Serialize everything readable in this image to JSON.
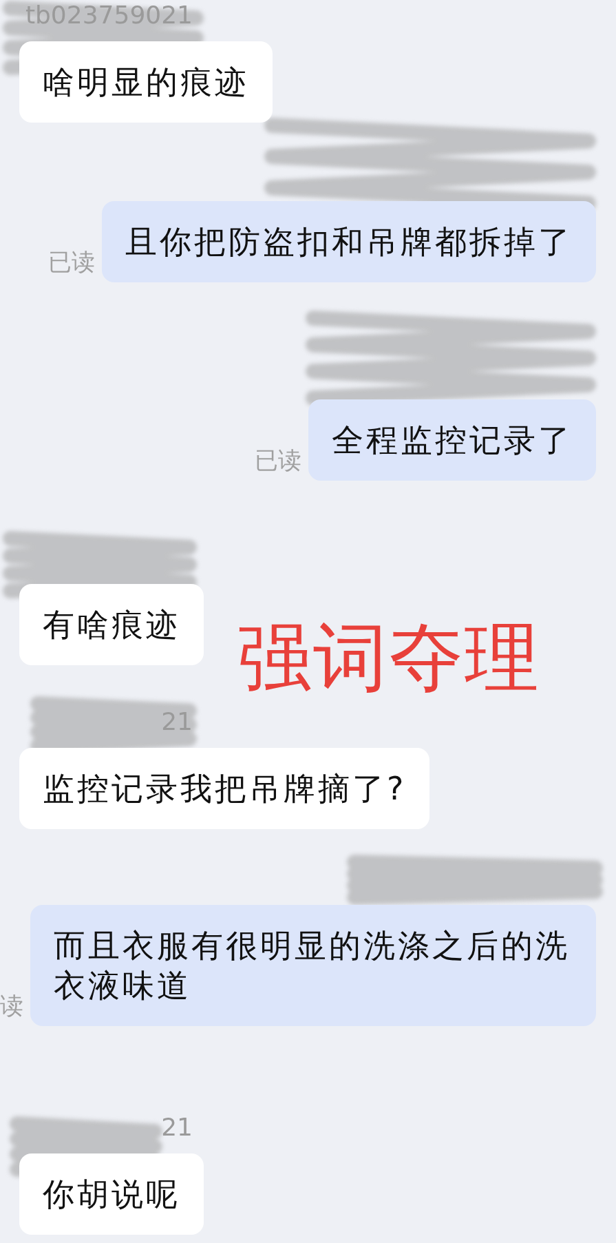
{
  "messages": [
    {
      "kind": "incoming",
      "sender": "tb023759021",
      "text": "啥明显的痕迹"
    },
    {
      "kind": "outgoing",
      "text": "且你把防盗扣和吊牌都拆掉了",
      "read_status": "已读"
    },
    {
      "kind": "outgoing",
      "text": "全程监控记录了",
      "read_status": "已读"
    },
    {
      "kind": "incoming",
      "text": "有啥痕迹"
    },
    {
      "kind": "incoming",
      "sender": "21",
      "text": "监控记录我把吊牌摘了?"
    },
    {
      "kind": "outgoing",
      "text": "而且衣服有很明显的洗涤之后的洗衣液味道",
      "read_status": "读"
    },
    {
      "kind": "incoming",
      "sender": "21",
      "text": "你胡说呢"
    }
  ],
  "overlay_caption": "强词夺理"
}
